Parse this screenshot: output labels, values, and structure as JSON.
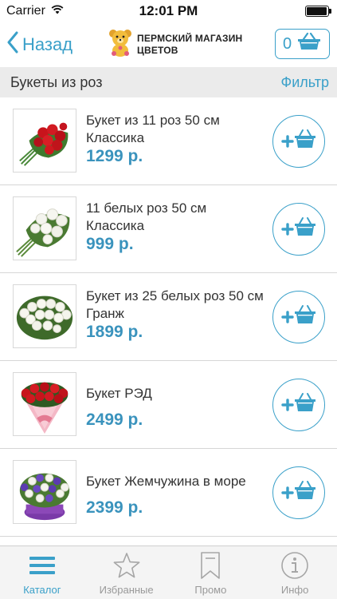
{
  "status_bar": {
    "carrier": "Carrier",
    "time": "12:01 PM",
    "battery_level": 0.95
  },
  "nav": {
    "back_label": "Назад",
    "logo_line1": "ПЕРМСКИЙ МАГАЗИН",
    "logo_line2": "ЦВЕТОВ",
    "cart_count": "0"
  },
  "section": {
    "title": "Букеты из роз",
    "filter_label": "Фильтр"
  },
  "products": [
    {
      "name": "Букет из 11 роз 50 см Классика",
      "price": "1299 р.",
      "image": "red-roses-bouquet"
    },
    {
      "name": "11 белых роз 50 см Классика",
      "price": "999 р.",
      "image": "white-roses-bouquet"
    },
    {
      "name": "Букет из 25 белых роз 50 см Гранж",
      "price": "1899 р.",
      "image": "white-roses-grunge-bouquet"
    },
    {
      "name": "Букет РЭД",
      "price": "2499 р.",
      "image": "red-bouquet-pink-wrap"
    },
    {
      "name": "Букет Жемчужина в море",
      "price": "2399 р.",
      "image": "purple-white-basket"
    }
  ],
  "tabs": [
    {
      "label": "Каталог",
      "icon": "menu-icon",
      "active": true
    },
    {
      "label": "Избранные",
      "icon": "star-icon",
      "active": false
    },
    {
      "label": "Промо",
      "icon": "bookmark-icon",
      "active": false
    },
    {
      "label": "Инфо",
      "icon": "info-icon",
      "active": false
    }
  ],
  "colors": {
    "accent": "#3aa0c9",
    "price": "#3a93bd",
    "section_bg": "#ebebeb",
    "tab_bar_bg": "#f4f4f4"
  }
}
